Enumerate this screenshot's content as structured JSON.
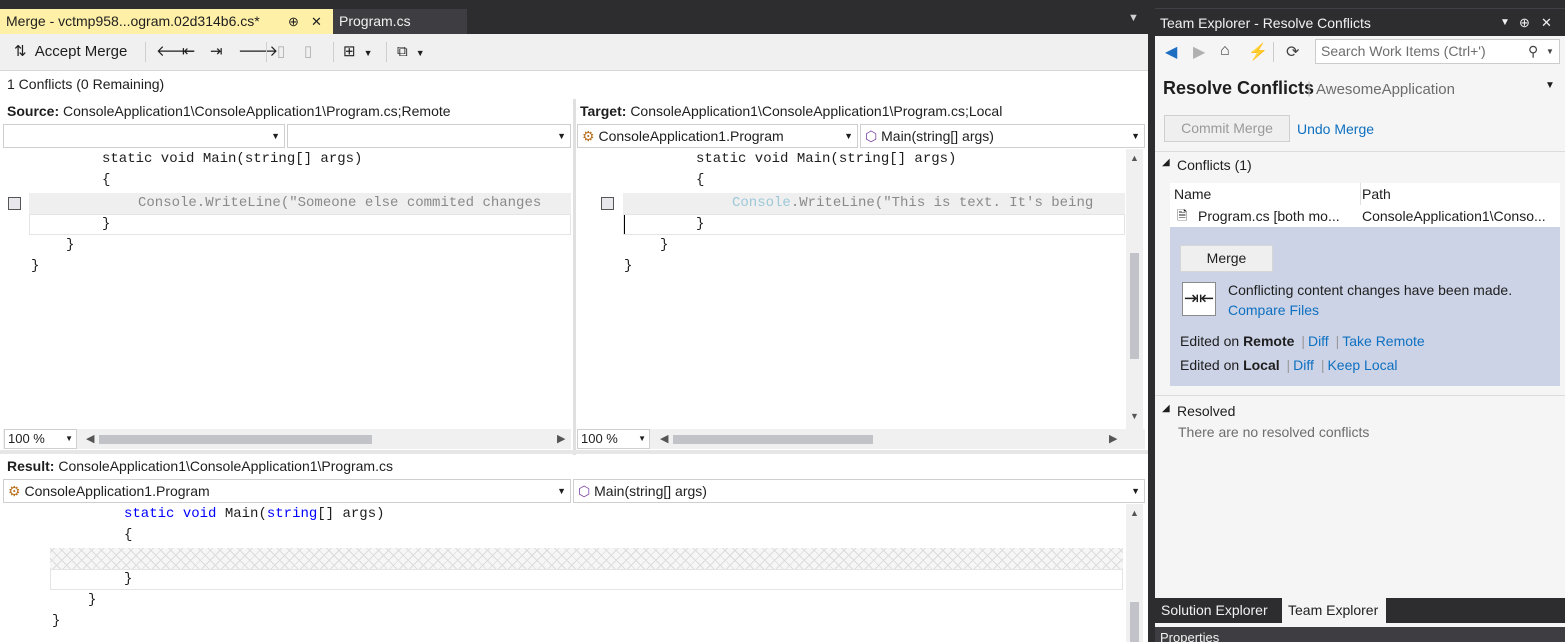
{
  "tabs": {
    "active": "Merge - vctmp958...ogram.02d314b6.cs*",
    "other": "Program.cs",
    "pin_glyph": "⊕",
    "close_glyph": "✕",
    "overflow_glyph": "▼"
  },
  "toolbar": {
    "accept_merge": "Accept Merge",
    "accept_glyph": "⇅"
  },
  "status": "1 Conflicts (0 Remaining)",
  "source": {
    "label": "Source:",
    "path": "ConsoleApplication1\\ConsoleApplication1\\Program.cs;Remote",
    "combo1": "",
    "combo2": "",
    "lines": [
      "static void Main(string[] args)",
      "{",
      "Console.WriteLine(\"Someone else commited changes",
      "}",
      "}",
      "}"
    ],
    "zoom": "100 %"
  },
  "target": {
    "label": "Target:",
    "path": "ConsoleApplication1\\ConsoleApplication1\\Program.cs;Local",
    "combo1": "ConsoleApplication1.Program",
    "combo2": "Main(string[] args)",
    "lines": [
      "static void Main(string[] args)",
      "{",
      "Console",
      ".WriteLine(\"This is text. It's being",
      "}",
      "}",
      "}"
    ],
    "zoom": "100 %"
  },
  "result": {
    "label": "Result:",
    "path": "ConsoleApplication1\\ConsoleApplication1\\Program.cs",
    "combo1": "ConsoleApplication1.Program",
    "combo2": "Main(string[] args)",
    "kw_static": "static",
    "kw_void": "void",
    "main_a": " Main(",
    "kw_string": "string",
    "main_b": "[] args)",
    "lines": [
      "{",
      "}",
      "}",
      "}"
    ]
  },
  "team_explorer": {
    "title": "Team Explorer - Resolve Conflicts",
    "search_placeholder": "Search Work Items (Ctrl+')",
    "page_title": "Resolve Conflicts",
    "project": "AwesomeApplication",
    "commit_merge": "Commit Merge",
    "undo_merge": "Undo Merge",
    "conflicts_header": "Conflicts (1)",
    "col_name": "Name",
    "col_path": "Path",
    "row_name": "Program.cs [both mo...",
    "row_path": "ConsoleApplication1\\Conso...",
    "merge_button": "Merge",
    "conflict_msg": "Conflicting content changes have been made.",
    "compare_files": "Compare Files",
    "edited_on": "Edited on",
    "remote": "Remote",
    "local": "Local",
    "diff": "Diff",
    "take_remote": "Take Remote",
    "keep_local": "Keep Local",
    "resolved_header": "Resolved",
    "resolved_empty": "There are no resolved conflicts",
    "tab_solution": "Solution Explorer",
    "tab_team": "Team Explorer",
    "properties": "Properties"
  },
  "colors": {
    "accent": "#0e70c0",
    "active_tab": "#fff0a8",
    "chrome_dark": "#2d2d30"
  }
}
